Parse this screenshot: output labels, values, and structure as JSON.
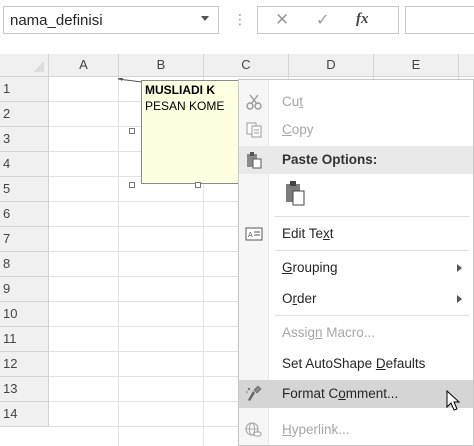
{
  "formula_bar": {
    "name_box": "nama_definisi",
    "separator": "⋮",
    "cancel_glyph": "✕",
    "enter_glyph": "✓",
    "fx_label": "fx"
  },
  "grid": {
    "columns": [
      "A",
      "B",
      "C",
      "D",
      "E"
    ],
    "rows": [
      "1",
      "2",
      "3",
      "4",
      "5",
      "6",
      "7",
      "8",
      "9",
      "10",
      "11",
      "12",
      "13",
      "14"
    ]
  },
  "comment": {
    "author": "MUSLIADI K",
    "text": "PESAN KOME"
  },
  "context_menu": {
    "items": [
      {
        "id": "cut",
        "pre": "Cu",
        "u": "t",
        "post": "",
        "icon": "scissors-icon",
        "disabled": true
      },
      {
        "id": "copy",
        "pre": "",
        "u": "C",
        "post": "opy",
        "icon": "copy-icon",
        "disabled": true
      },
      {
        "id": "paste-options",
        "label": "Paste Options:",
        "icon": "paste-icon"
      },
      {
        "id": "edit-text",
        "pre": "Edit Te",
        "u": "x",
        "post": "t",
        "icon": "edit-text-icon"
      },
      {
        "id": "grouping",
        "pre": "",
        "u": "G",
        "post": "rouping",
        "submenu": true
      },
      {
        "id": "order",
        "pre": "O",
        "u": "r",
        "post": "der",
        "submenu": true
      },
      {
        "id": "assign-macro",
        "pre": "Assig",
        "u": "n",
        "post": " Macro...",
        "disabled": true
      },
      {
        "id": "set-autoshape-defaults",
        "pre": "Set AutoShape ",
        "u": "D",
        "post": "efaults"
      },
      {
        "id": "format-comment",
        "pre": "Format C",
        "u": "o",
        "post": "mment...",
        "icon": "format-comment-icon"
      },
      {
        "id": "hyperlink",
        "pre": "",
        "u": "H",
        "post": "yperlink...",
        "icon": "hyperlink-icon",
        "disabled": true
      }
    ]
  },
  "colors": {
    "comment_bg": "#ffffe1",
    "menu_hover": "#d5d5d5",
    "menu_header": "#e9e9e9",
    "disabled_text": "#a6a6a6"
  }
}
